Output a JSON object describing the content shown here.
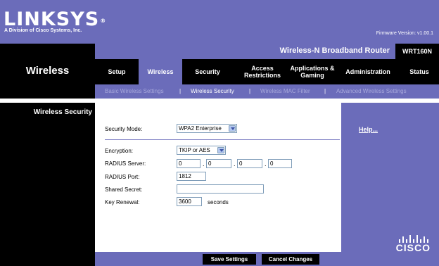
{
  "brand": {
    "logo": "LINKSYS",
    "registered_mark": "®",
    "subtitle": "A Division of Cisco Systems, Inc.",
    "firmware": "Firmware Version: v1.00.1",
    "cisco": "CISCO"
  },
  "product": {
    "name": "Wireless-N Broadband Router",
    "model": "WRT160N"
  },
  "section_title": "Wireless",
  "nav": {
    "tabs": [
      {
        "label": "Setup"
      },
      {
        "label": "Wireless"
      },
      {
        "label": "Security"
      },
      {
        "label": "Access Restrictions"
      },
      {
        "label": "Applications & Gaming"
      },
      {
        "label": "Administration"
      },
      {
        "label": "Status"
      }
    ],
    "active_tab": "Wireless",
    "subtabs": [
      {
        "label": "Basic Wireless Settings"
      },
      {
        "label": "Wireless Security"
      },
      {
        "label": "Wireless MAC Filter"
      },
      {
        "label": "Advanced Wireless Settings"
      }
    ],
    "separator": "|",
    "active_subtab": "Wireless Security"
  },
  "sidebar": {
    "title": "Wireless Security"
  },
  "form": {
    "security_mode": {
      "label": "Security Mode:",
      "value": "WPA2 Enterprise"
    },
    "encryption": {
      "label": "Encryption:",
      "value": "TKIP or AES"
    },
    "radius_server": {
      "label": "RADIUS Server:",
      "octets": [
        "0",
        "0",
        "0",
        "0"
      ],
      "separator": "."
    },
    "radius_port": {
      "label": "RADIUS Port:",
      "value": "1812"
    },
    "shared_secret": {
      "label": "Shared Secret:",
      "value": ""
    },
    "key_renewal": {
      "label": "Key Renewal:",
      "value": "3600",
      "unit": "seconds"
    }
  },
  "help": {
    "label": "Help..."
  },
  "actions": {
    "save": "Save Settings",
    "cancel": "Cancel Changes"
  },
  "colors": {
    "brand_purple": "#6b6cba",
    "dark": "#000000",
    "inactive_subtab": "#a8a9dc"
  }
}
